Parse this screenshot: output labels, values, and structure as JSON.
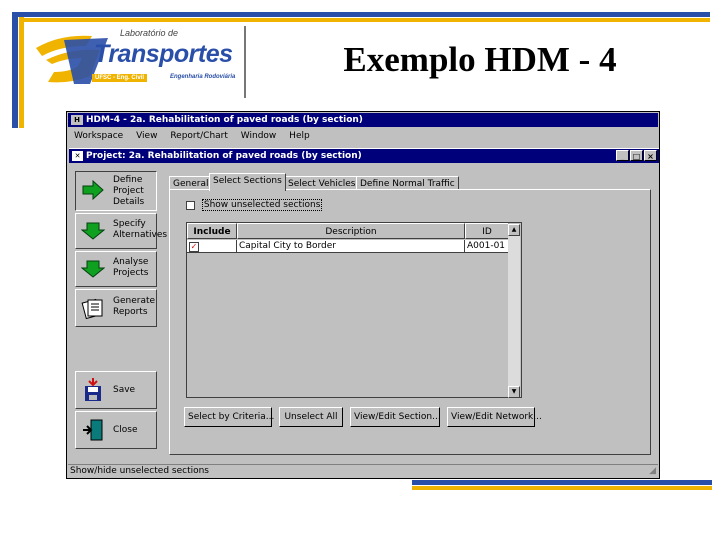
{
  "slide": {
    "title": "Exemplo HDM - 4",
    "logo": {
      "top_text": "Laboratório de",
      "brand": "Transportes",
      "left_tag": "UFSC - Eng. Civil",
      "right_tag": "Engenharia Rodoviária"
    }
  },
  "app": {
    "title": "HDM-4 - 2a. Rehabilitation of paved roads (by section)",
    "menu": [
      "Workspace",
      "View",
      "Report/Chart",
      "Window",
      "Help"
    ],
    "project_window": {
      "title": "Project: 2a. Rehabilitation of paved roads (by section)",
      "controls": [
        "_",
        "□",
        "×"
      ]
    },
    "sidebar": [
      {
        "label": "Define\nProject\nDetails",
        "icon": "green-arrow-right-icon"
      },
      {
        "label": "Specify\nAlternatives",
        "icon": "green-arrow-down-icon"
      },
      {
        "label": "Analyse\nProjects",
        "icon": "green-arrow-down-icon"
      },
      {
        "label": "Generate\nReports",
        "icon": "reports-icon"
      },
      {
        "label": "Save",
        "icon": "save-icon"
      },
      {
        "label": "Close",
        "icon": "exit-door-icon"
      }
    ],
    "tabs": [
      "General",
      "Select Sections",
      "Select Vehicles",
      "Define Normal Traffic"
    ],
    "active_tab": "Select Sections",
    "show_unselected": {
      "label": "Show unselected sections",
      "checked": false
    },
    "table": {
      "columns": [
        "Include",
        "Description",
        "ID"
      ],
      "rows": [
        {
          "include": true,
          "description": "Capital City to Border",
          "id": "A001-01"
        }
      ]
    },
    "buttons": [
      "Select by Criteria...",
      "Unselect All",
      "View/Edit Section...",
      "View/Edit Network..."
    ],
    "status": "Show/hide unselected sections"
  },
  "colors": {
    "accent_blue": "#2a4fa8",
    "accent_yellow": "#f0b400",
    "titlebar": "#00007b",
    "window_face": "#c0c0c0"
  }
}
